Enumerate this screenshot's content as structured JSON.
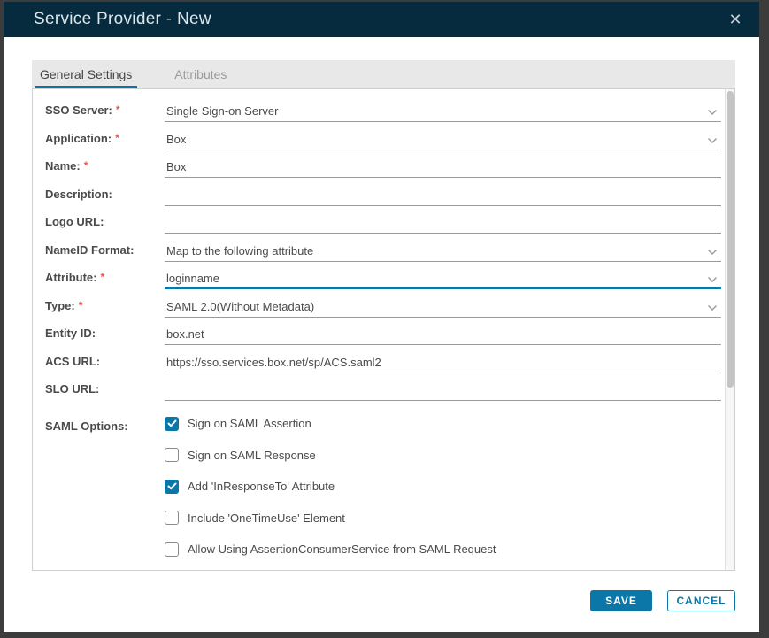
{
  "dialog": {
    "title": "Service Provider - New"
  },
  "icons": {
    "close": "✕",
    "chevron_down": "chevron-down-icon",
    "check": "check-icon"
  },
  "required_marker": "*",
  "tabs": [
    {
      "label": "General Settings",
      "active": true
    },
    {
      "label": "Attributes",
      "active": false
    }
  ],
  "form": {
    "fields": [
      {
        "label": "SSO Server:",
        "required": true,
        "control": "select",
        "value": "Single Sign-on Server",
        "focused": false
      },
      {
        "label": "Application:",
        "required": true,
        "control": "select",
        "value": "Box",
        "focused": false
      },
      {
        "label": "Name:",
        "required": true,
        "control": "text",
        "value": "Box",
        "focused": false
      },
      {
        "label": "Description:",
        "required": false,
        "control": "text",
        "value": "",
        "focused": false
      },
      {
        "label": "Logo URL:",
        "required": false,
        "control": "text",
        "value": "",
        "focused": false
      },
      {
        "label": "NameID Format:",
        "required": false,
        "control": "select",
        "value": "Map to the following attribute",
        "focused": false
      },
      {
        "label": "Attribute:",
        "required": true,
        "control": "select",
        "value": "loginname",
        "focused": true
      },
      {
        "label": "Type:",
        "required": true,
        "control": "select",
        "value": "SAML 2.0(Without Metadata)",
        "focused": false
      },
      {
        "label": "Entity ID:",
        "required": false,
        "control": "text",
        "value": "box.net",
        "focused": false
      },
      {
        "label": "ACS URL:",
        "required": false,
        "control": "text",
        "value": "https://sso.services.box.net/sp/ACS.saml2",
        "focused": false
      },
      {
        "label": "SLO URL:",
        "required": false,
        "control": "text",
        "value": "",
        "focused": false
      }
    ],
    "saml_options": {
      "label": "SAML Options:",
      "checkboxes": [
        {
          "label": "Sign on SAML Assertion",
          "checked": true
        },
        {
          "label": "Sign on SAML Response",
          "checked": false
        },
        {
          "label": "Add 'InResponseTo' Attribute",
          "checked": true
        },
        {
          "label": "Include 'OneTimeUse' Element",
          "checked": false
        },
        {
          "label": "Allow Using AssertionConsumerService from SAML Request",
          "checked": false
        }
      ]
    }
  },
  "footer": {
    "save_label": "SAVE",
    "cancel_label": "CANCEL"
  },
  "colors": {
    "accent": "#0b77a9",
    "header_bg": "#072b3e",
    "required": "#e8564e"
  }
}
